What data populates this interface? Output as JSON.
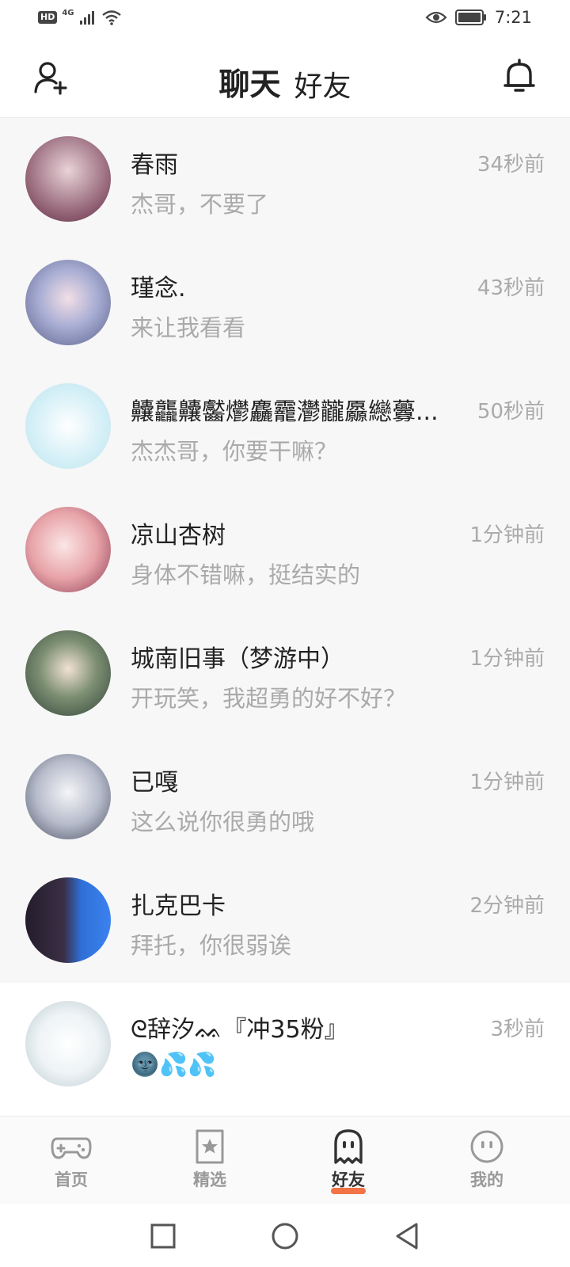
{
  "status": {
    "hd": "HD",
    "network": "4G",
    "time": "7:21"
  },
  "header": {
    "tabs": [
      {
        "label": "聊天"
      },
      {
        "label": "好友"
      }
    ],
    "icons": {
      "left": "add-friend-icon",
      "right": "bell-icon"
    }
  },
  "chats": [
    {
      "name": "春雨",
      "message": "杰哥，不要了",
      "time": "34秒前",
      "avatar_color": "#8c5a6e"
    },
    {
      "name": "瑾念.",
      "message": "来让我看看",
      "time": "43秒前",
      "avatar_color": "#7a86b8"
    },
    {
      "name": "齉龘齉齾爩麤龗灪龖厵纞虋...",
      "message": "杰杰哥，你要干嘛？",
      "time": "50秒前",
      "avatar_color": "#cdeef6"
    },
    {
      "name": "凉山杏树",
      "message": "身体不错嘛，挺结实的",
      "time": "1分钟前",
      "avatar_color": "#e7a3a8"
    },
    {
      "name": "城南旧事（梦游中）",
      "message": "开玩笑，我超勇的好不好？",
      "time": "1分钟前",
      "avatar_color": "#4f6b5a"
    },
    {
      "name": "已嘎",
      "message": "这么说你很勇的哦",
      "time": "1分钟前",
      "avatar_color": "#9aa4b8"
    },
    {
      "name": "扎克巴卡",
      "message": "拜托，你很弱诶",
      "time": "2分钟前",
      "avatar_color": "#2f6fd6"
    },
    {
      "name": "ᘓ辞汐ᨐ『冲35粉』",
      "message": "🌚💦💦",
      "time": "3秒前",
      "avatar_color": "#e8eef0"
    }
  ],
  "nav": [
    {
      "label": "首页",
      "icon": "gamepad-icon"
    },
    {
      "label": "精选",
      "icon": "star-bookmark-icon"
    },
    {
      "label": "好友",
      "icon": "ghost-icon",
      "active": true
    },
    {
      "label": "我的",
      "icon": "smile-face-icon"
    }
  ],
  "system_nav": {
    "icons": [
      "recent-apps-icon",
      "home-circle-icon",
      "back-triangle-icon"
    ]
  }
}
